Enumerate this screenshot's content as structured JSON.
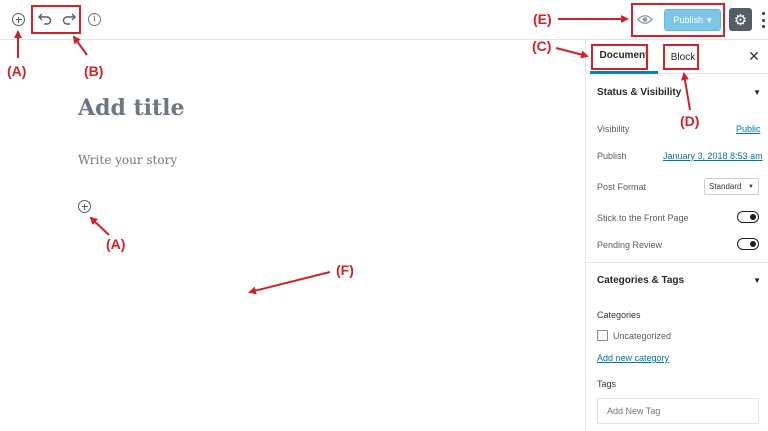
{
  "toolbar": {
    "publish_label": "Publish",
    "publish_caret": "▾"
  },
  "editor": {
    "title_placeholder": "Add title",
    "body_placeholder": "Write your story"
  },
  "sidebar": {
    "tabs": [
      {
        "label": "Document",
        "active": true
      },
      {
        "label": "Block",
        "active": false
      }
    ],
    "close_label": "✕",
    "status_visibility": {
      "heading": "Status & Visibility",
      "visibility_label": "Visibility",
      "visibility_value": "Public",
      "publish_label": "Publish",
      "publish_value": "January 3, 2018 8:53 am",
      "post_format_label": "Post Format",
      "post_format_value": "Standard",
      "sticky_label": "Stick to the Front Page",
      "sticky_on": false,
      "pending_label": "Pending Review",
      "pending_on": false
    },
    "categories_tags": {
      "heading": "Categories & Tags",
      "categories_label": "Categories",
      "category_items": [
        "Uncategorized"
      ],
      "add_category": "Add new category",
      "tags_label": "Tags",
      "tag_placeholder": "Add New Tag"
    }
  },
  "annotations": {
    "a": "(A)",
    "b": "(B)",
    "c": "(C)",
    "d": "(D)",
    "e": "(E)",
    "f": "(F)"
  },
  "colors": {
    "annotation": "#d22128",
    "accent": "#0085ba",
    "publish_button": "#7ec6e8"
  }
}
